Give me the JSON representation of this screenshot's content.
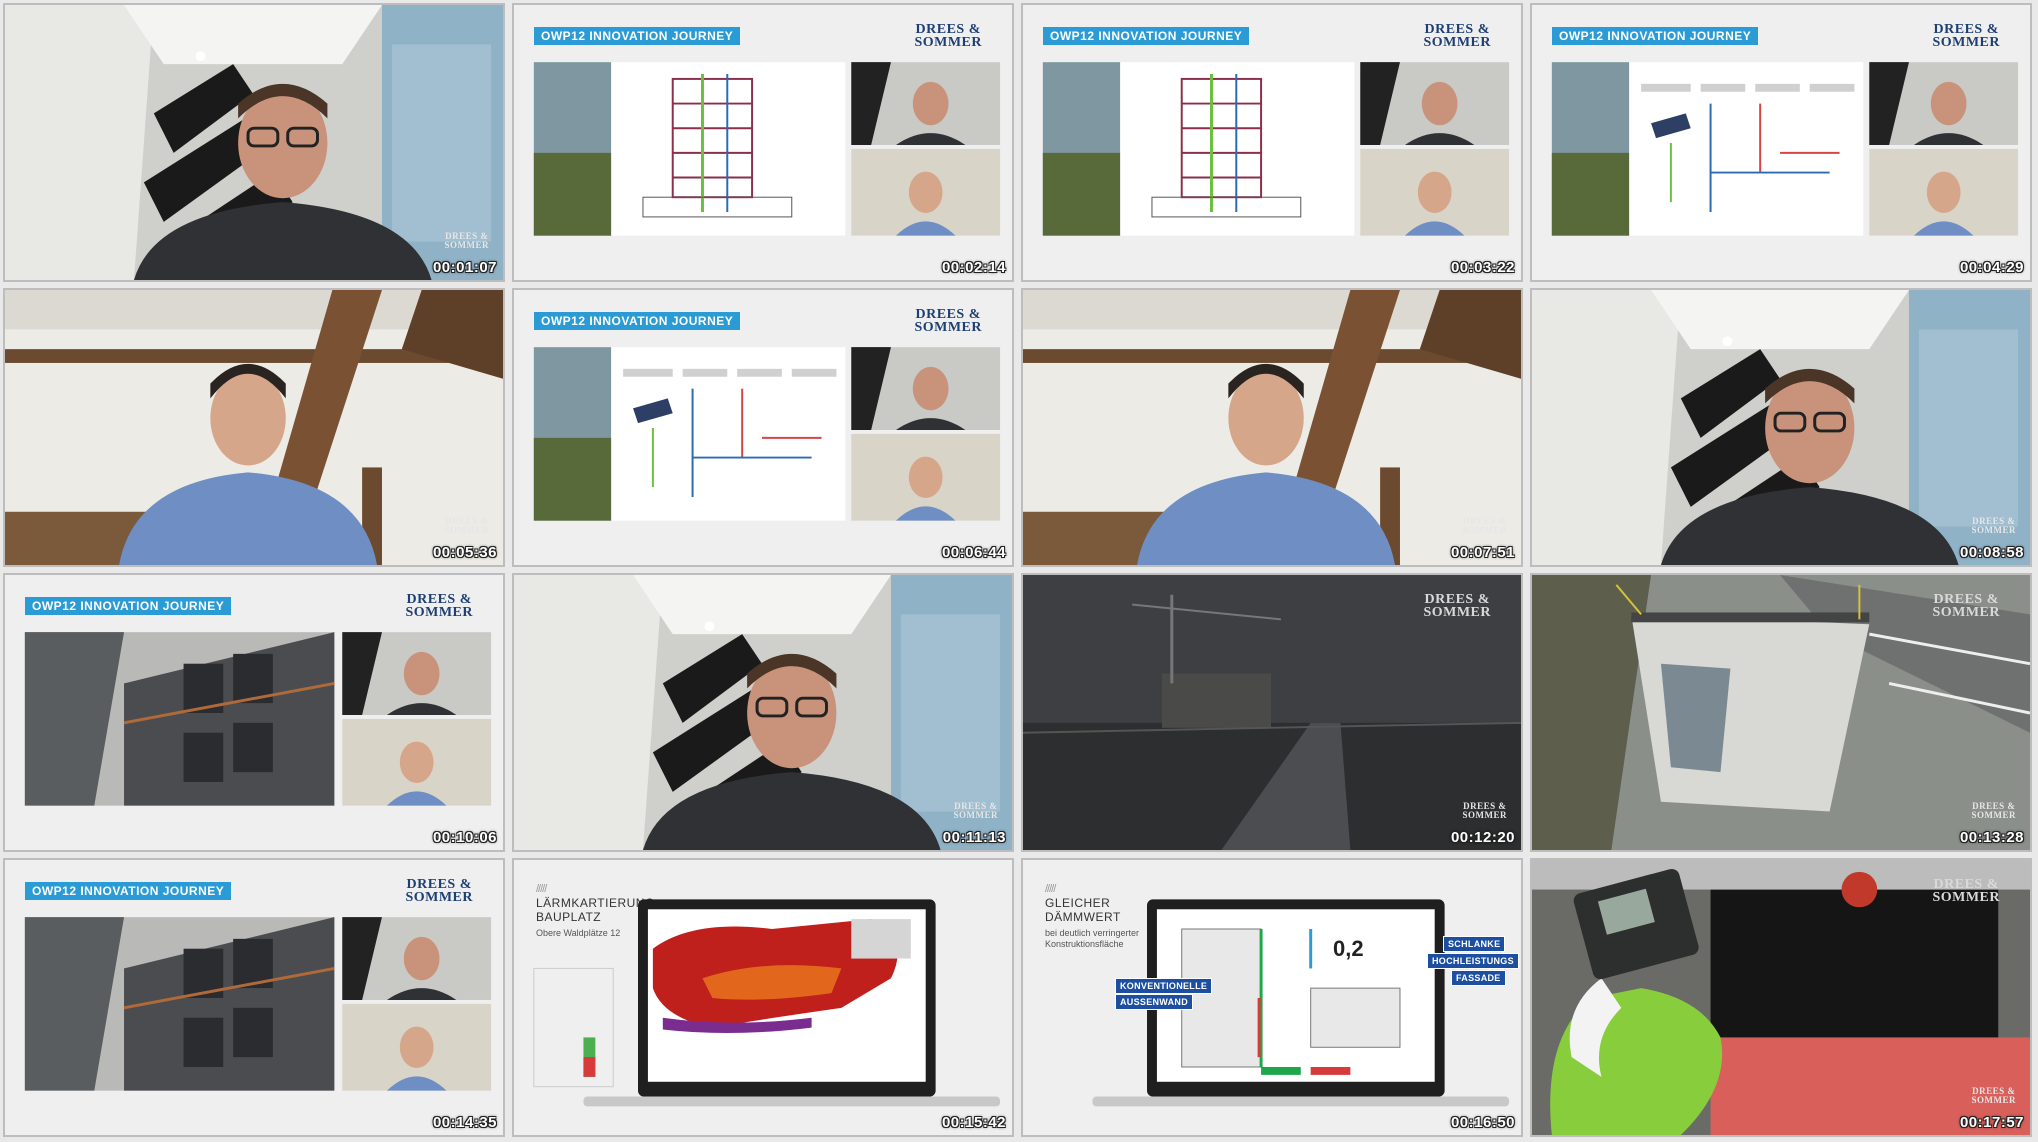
{
  "tiles": [
    {
      "type": "webcam_a",
      "time": "00:01:07"
    },
    {
      "type": "slide_diagram",
      "time": "00:02:14"
    },
    {
      "type": "slide_diagram",
      "time": "00:03:22"
    },
    {
      "type": "slide_energy",
      "time": "00:04:29"
    },
    {
      "type": "webcam_b",
      "time": "00:05:36"
    },
    {
      "type": "slide_energy",
      "time": "00:06:44"
    },
    {
      "type": "webcam_b",
      "time": "00:07:51"
    },
    {
      "type": "webcam_a",
      "time": "00:08:58"
    },
    {
      "type": "slide_photo",
      "time": "00:10:06"
    },
    {
      "type": "webcam_a",
      "time": "00:11:13"
    },
    {
      "type": "night_site",
      "time": "00:12:20"
    },
    {
      "type": "crane_module",
      "time": "00:13:28"
    },
    {
      "type": "slide_photo",
      "time": "00:14:35"
    },
    {
      "type": "slide_noise",
      "time": "00:15:42"
    },
    {
      "type": "slide_insulation",
      "time": "00:16:50"
    },
    {
      "type": "glove",
      "time": "00:17:57"
    }
  ],
  "brand": {
    "logo_line1": "DREES &",
    "logo_line2": "SOMMER",
    "banner": "OWP12 INNOVATION JOURNEY",
    "accent": "#2b9bd5",
    "navy": "#1c4fa0"
  },
  "noise_slide": {
    "title_line1": "LÄRMKARTIERUNG",
    "title_line2": "BAUPLATZ",
    "subtitle": "Obere Waldplätze 12"
  },
  "insulation_slide": {
    "title_line1": "GLEICHER",
    "title_line2": "DÄMMWERT",
    "subtitle_line1": "bei deutlich verringerter",
    "subtitle_line2": "Konstruktionsfläche",
    "value": "0,2",
    "tags": [
      "KONVENTIONELLE",
      "AUSSENWAND",
      "SCHLANKE",
      "HOCHLEISTUNGS",
      "FASSADE"
    ]
  }
}
